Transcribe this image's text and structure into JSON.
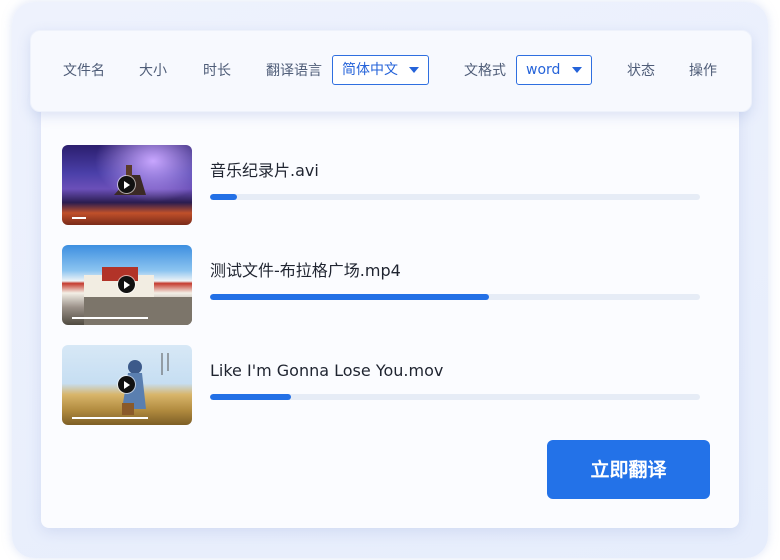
{
  "header": {
    "col_filename": "文件名",
    "col_size": "大小",
    "col_duration": "时长",
    "col_language": "翻译语言",
    "language_value": "简体中文",
    "col_format": "文格式",
    "format_value": "word",
    "col_status": "状态",
    "col_action": "操作"
  },
  "files": [
    {
      "name": "音乐纪录片.avi",
      "progress_fraction": 0.055
    },
    {
      "name": "测试文件-布拉格广场.mp4",
      "progress_fraction": 0.57
    },
    {
      "name": "Like I'm Gonna Lose You.mov",
      "progress_fraction": 0.165
    }
  ],
  "actions": {
    "translate_label": "立即翻译"
  },
  "colors": {
    "accent": "#2372e8",
    "track": "#e6ecf6",
    "text": "#1f2430"
  },
  "icons": [
    "play-icon",
    "chevron-down-icon"
  ]
}
